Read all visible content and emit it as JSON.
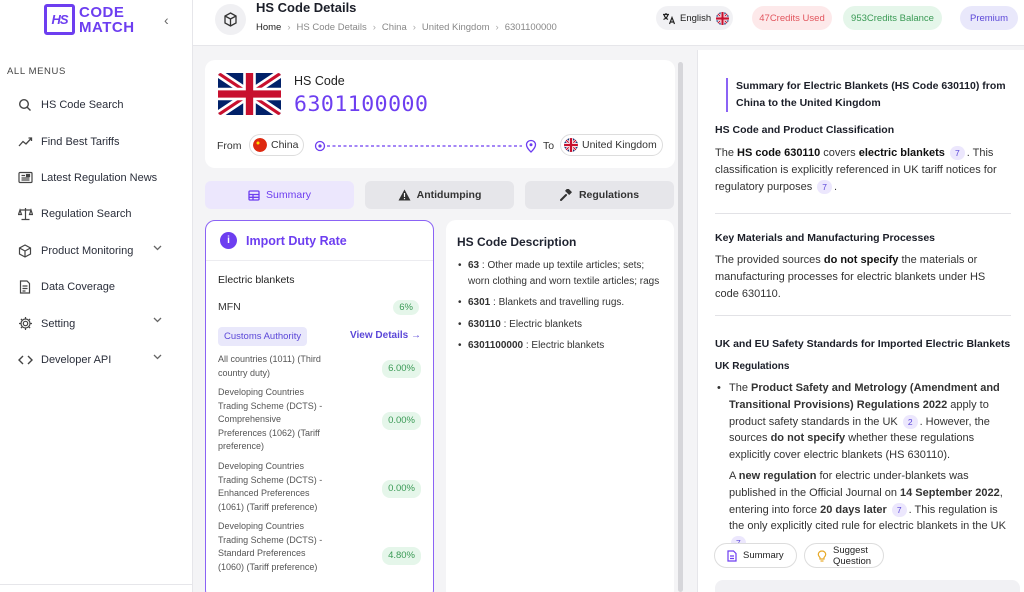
{
  "brand": {
    "mark": "HS",
    "line1": "CODE",
    "line2": "MATCH",
    "color": "#6d3ef0"
  },
  "sidebar": {
    "section_title": "ALL MENUS",
    "items": [
      {
        "label": "HS Code Search",
        "icon": "search-icon"
      },
      {
        "label": "Find Best Tariffs",
        "icon": "trend-icon"
      },
      {
        "label": "Latest Regulation News",
        "icon": "news-icon"
      },
      {
        "label": "Regulation Search",
        "icon": "scale-icon"
      },
      {
        "label": "Product Monitoring",
        "icon": "box-icon",
        "has_submenu": true
      },
      {
        "label": "Data Coverage",
        "icon": "document-icon"
      },
      {
        "label": "Setting",
        "icon": "gear-icon",
        "has_submenu": true
      },
      {
        "label": "Developer API",
        "icon": "code-icon",
        "has_submenu": true
      }
    ]
  },
  "header": {
    "title": "HS Code Details",
    "breadcrumb": [
      "Home",
      "HS Code Details",
      "China",
      "United Kingdom",
      "6301100000"
    ],
    "language": "English",
    "credits_used": "47Credits Used",
    "credits_balance": "953Credits Balance",
    "plan": "Premium"
  },
  "hs_card": {
    "label": "HS Code",
    "code": "6301100000",
    "from_label": "From",
    "from_country": "China",
    "to_label": "To",
    "to_country": "United Kingdom"
  },
  "tabs": [
    {
      "label": "Summary",
      "icon": "table-icon",
      "active": true
    },
    {
      "label": "Antidumping",
      "icon": "warning-icon",
      "active": false
    },
    {
      "label": "Regulations",
      "icon": "gavel-icon",
      "active": false
    }
  ],
  "duty": {
    "title": "Import Duty Rate",
    "product": "Electric blankets",
    "mfn_label": "MFN",
    "mfn_value": "6%",
    "authority": "Customs Authority",
    "view_details": "View Details →",
    "rates": [
      {
        "name": "All countries (1011) (Third country duty)",
        "value": "6.00%"
      },
      {
        "name": "Developing Countries Trading Scheme (DCTS) - Comprehensive Preferences (1062) (Tariff preference)",
        "value": "0.00%"
      },
      {
        "name": "Developing Countries Trading Scheme (DCTS) - Enhanced Preferences (1061) (Tariff preference)",
        "value": "0.00%"
      },
      {
        "name": "Developing Countries Trading Scheme (DCTS) - Standard Preferences (1060) (Tariff preference)",
        "value": "4.80%"
      }
    ]
  },
  "description": {
    "title": "HS Code Description",
    "items": [
      {
        "code": "63",
        "text": ": Other made up textile articles; sets; worn clothing and worn textile articles; rags"
      },
      {
        "code": "6301",
        "text": ": Blankets and travelling rugs."
      },
      {
        "code": "630110",
        "text": ": Electric blankets"
      },
      {
        "code": "6301100000",
        "text": ": Electric blankets"
      }
    ]
  },
  "panel": {
    "summary_title": "Summary for Electric Blankets (HS Code 630110) from China to the United Kingdom",
    "s1_title": "HS Code and Product Classification",
    "s1": {
      "t1": "The ",
      "b1": "HS code 630110",
      "t2": " covers ",
      "b2": "electric blankets",
      "c1": "7",
      "t3": ". This classification is explicitly referenced in UK tariff notices for regulatory purposes",
      "c2": "7",
      "t4": "."
    },
    "s2_title": "Key Materials and Manufacturing Processes",
    "s2": {
      "t1": "The provided sources ",
      "b1": "do not specify",
      "t2": " the materials or manufacturing processes for electric blankets under HS code 630110."
    },
    "s3_title": "UK and EU Safety Standards for Imported Electric Blankets",
    "s3_sub": "UK Regulations",
    "b1": {
      "t1": "The ",
      "b1": "Product Safety and Metrology (Amendment and Transitional Provisions) Regulations 2022",
      "t2": " apply to product safety standards in the UK",
      "c1": "2",
      "t3": ". However, the sources ",
      "b2": "do not specify",
      "t4": " whether these regulations explicitly cover electric blankets (HS 630110)."
    },
    "b2": {
      "t1": "A ",
      "b1": "new regulation",
      "t2": " for electric under-blankets was published in the Official Journal on ",
      "b2": "14 September 2022",
      "t3": ", entering into force ",
      "b3": "20 days later",
      "c1": "7",
      "t4": ". This regulation is the only explicitly cited rule for electric blankets in the UK",
      "c2": "7"
    },
    "chips": [
      "Summary",
      "Suggest Question"
    ]
  }
}
